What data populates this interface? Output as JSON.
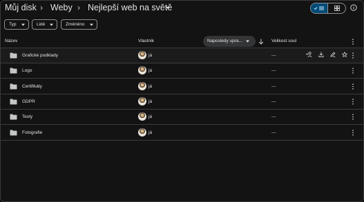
{
  "breadcrumb": {
    "root": "Můj disk",
    "parent": "Weby",
    "current": "Nejlepší web na světě"
  },
  "filters": {
    "type": "Typ",
    "people": "Lidé",
    "modified": "Změněno"
  },
  "columns": {
    "name": "Název",
    "owner": "Vlastník",
    "modified": "Naposledy upra...",
    "size": "Velikost soul"
  },
  "rows": [
    {
      "name": "Grafické podklady",
      "owner": "já",
      "size": "—"
    },
    {
      "name": "Logo",
      "owner": "já",
      "size": "—"
    },
    {
      "name": "Certifikáty",
      "owner": "já",
      "size": "—"
    },
    {
      "name": "GDPR",
      "owner": "já",
      "size": "—"
    },
    {
      "name": "Texty",
      "owner": "já",
      "size": "—"
    },
    {
      "name": "Fotografie",
      "owner": "já",
      "size": "—"
    }
  ],
  "icons": {
    "folder": "folder-icon",
    "share": "add-person-icon",
    "download": "download-icon",
    "rename": "edit-icon",
    "star": "star-icon",
    "more": "more-vert-icon",
    "list_view": "list-view-icon",
    "grid_view": "grid-view-icon",
    "info": "info-icon"
  },
  "colors": {
    "background": "#131314",
    "accent": "#004a77",
    "text": "#e3e3e3",
    "divider": "#3c3c3c"
  }
}
